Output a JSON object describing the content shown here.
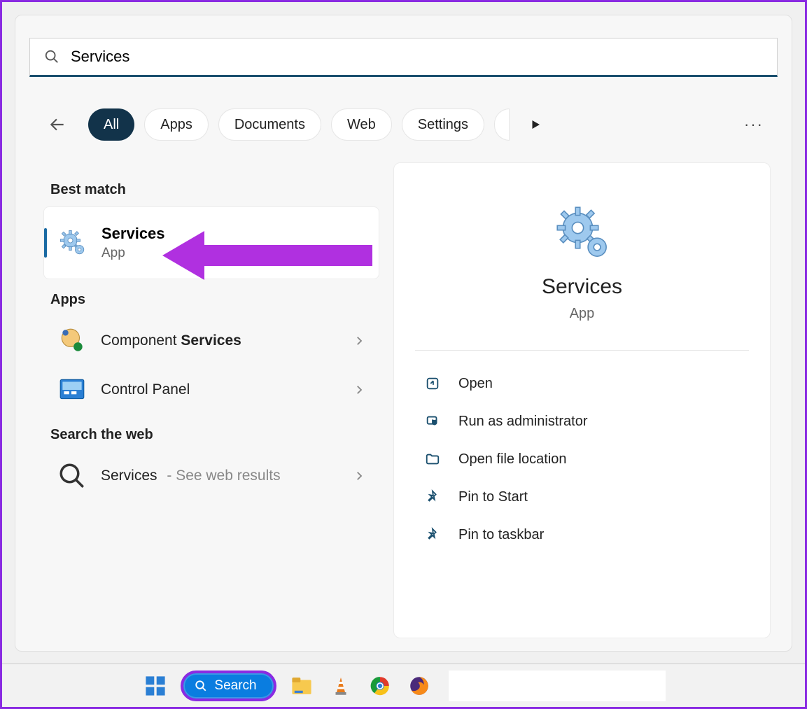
{
  "search": {
    "value": "Services"
  },
  "filters": {
    "back": "←",
    "all": "All",
    "apps": "Apps",
    "documents": "Documents",
    "web": "Web",
    "settings": "Settings",
    "more_hidden": "···"
  },
  "sections": {
    "best_match": "Best match",
    "apps": "Apps",
    "search_web": "Search the web"
  },
  "best_match": {
    "title": "Services",
    "subtitle": "App"
  },
  "apps_list": [
    {
      "prefix": "Component ",
      "bold": "Services"
    },
    {
      "prefix": "Control Panel",
      "bold": ""
    }
  ],
  "web_result": {
    "term": "Services",
    "suffix": " - See web results"
  },
  "detail": {
    "title": "Services",
    "subtitle": "App",
    "actions": [
      "Open",
      "Run as administrator",
      "Open file location",
      "Pin to Start",
      "Pin to taskbar"
    ]
  },
  "taskbar": {
    "search_label": "Search"
  }
}
